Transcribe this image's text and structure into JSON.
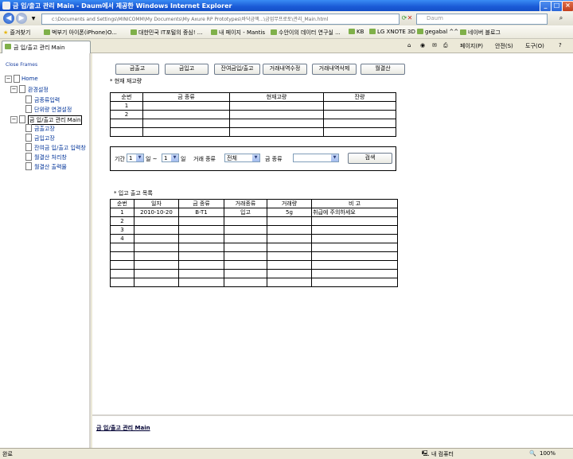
{
  "window": {
    "title": "금 입/출고 관리 Main - Daum에서 제공한 Windows Internet Explorer",
    "address": "c:\\Documents and Settings\\MINICOMM\\My Documents\\My Axure RP Prototypes\\바닥금액...\\금업무프로토\\관리_Main.html",
    "search_placeholder": "Daum",
    "min_icon": "minimize-icon",
    "max_icon": "maximize-icon",
    "close_icon": "close-icon"
  },
  "favorites": {
    "label": "즐겨찾기",
    "items": [
      "벅부기 아이폰(iPhone)O...",
      "대한민국 IT포털의 중심! ...",
      "내 페이지 - Mantis",
      "수안이의 데이터 연구실 ...",
      "KB",
      "LG XNOTE 3D",
      "gegabal ^^",
      "네이버 블로그"
    ]
  },
  "tab": {
    "label": "금 입/출고 관리 Main",
    "toolbar": [
      "페이지(P)",
      "안전(S)",
      "도구(O)"
    ]
  },
  "sidebar": {
    "close_frames": "Close Frames",
    "home": "Home",
    "group1": "환경설정",
    "group1_items": [
      "금종류입력",
      "단위량 연결설정"
    ],
    "group2": "금 입/출고 관리 Main",
    "group2_items": [
      "금출고장",
      "금입고장",
      "잔여금 입/출고 입력창",
      "월결산 처리창",
      "월결산 출력물"
    ]
  },
  "main": {
    "buttons": [
      "금출고",
      "금입고",
      "잔여금입/출고",
      "거래내역수정",
      "거래내역삭제",
      "월결산"
    ],
    "stock_title": "* 현재 재고량",
    "stock_headers": [
      "순번",
      "금 종류",
      "현재고량",
      "잔량"
    ],
    "stock_rows": [
      [
        "1",
        "",
        "",
        ""
      ],
      [
        "2",
        "",
        "",
        ""
      ],
      [
        "",
        "",
        "",
        ""
      ],
      [
        "",
        "",
        "",
        ""
      ]
    ],
    "filter": {
      "period_label": "기간",
      "month_from": "1",
      "mid": "일 ~",
      "month_to": "1",
      "day_label": "일",
      "type_label": "거래 종류",
      "type_value": "전체",
      "gold_label": "금 종류",
      "gold_value": "",
      "search_button": "검색"
    },
    "list_title": "* 입고 출고 목록",
    "list_headers": [
      "순번",
      "일자",
      "금 종류",
      "거래종류",
      "거래량",
      "비 고"
    ],
    "list_rows": [
      [
        "1",
        "2010-10-20",
        "B-T1",
        "입고",
        "5g",
        "취급에 주의하세요"
      ],
      [
        "2",
        "",
        "",
        "",
        "",
        ""
      ],
      [
        "3",
        "",
        "",
        "",
        "",
        ""
      ],
      [
        "4",
        "",
        "",
        "",
        "",
        ""
      ],
      [
        "",
        "",
        "",
        "",
        "",
        ""
      ],
      [
        "",
        "",
        "",
        "",
        "",
        ""
      ],
      [
        "",
        "",
        "",
        "",
        "",
        ""
      ],
      [
        "",
        "",
        "",
        "",
        "",
        ""
      ],
      [
        "",
        "",
        "",
        "",
        "",
        ""
      ]
    ]
  },
  "bottom": {
    "title": "금 입/출고 관리 Main"
  },
  "status": {
    "left": "완료",
    "zone": "내 컴퓨터",
    "zoom": "100%"
  }
}
